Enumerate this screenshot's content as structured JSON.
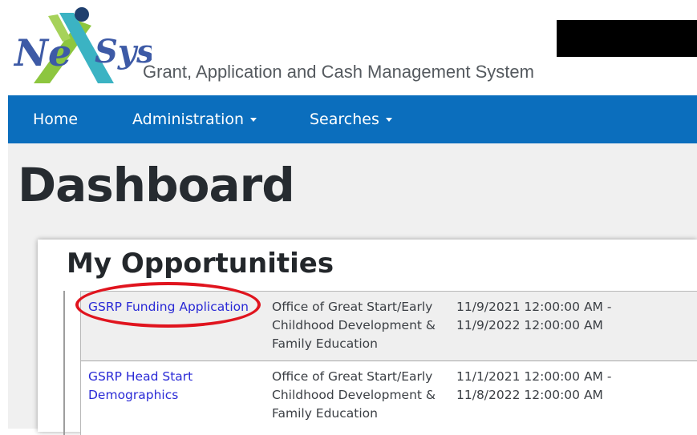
{
  "header": {
    "logo_text": "NeXSys",
    "tagline": "Grant, Application and Cash Management System",
    "colors": {
      "logo_blue": "#3d5aa6",
      "logo_green": "#8dc63f",
      "logo_teal": "#3bb3c3",
      "logo_navy": "#1f3f6e"
    }
  },
  "nav": {
    "items": [
      {
        "label": "Home",
        "has_dropdown": false
      },
      {
        "label": "Administration",
        "has_dropdown": true
      },
      {
        "label": "Searches",
        "has_dropdown": true
      }
    ],
    "color": "#0b6ebd"
  },
  "page": {
    "title": "Dashboard"
  },
  "opportunities": {
    "title": "My Opportunities",
    "rows": [
      {
        "name_lines": [
          "GSRP Funding Application"
        ],
        "office_lines": [
          "Office of Great Start/Early",
          "Childhood Development &",
          "Family Education"
        ],
        "date_lines": [
          "11/9/2021 12:00:00 AM -",
          "11/9/2022 12:00:00 AM"
        ]
      },
      {
        "name_lines": [
          "GSRP Head Start",
          "Demographics"
        ],
        "office_lines": [
          "Office of Great Start/Early",
          "Childhood Development &",
          "Family Education"
        ],
        "date_lines": [
          "11/1/2021 12:00:00 AM -",
          "11/8/2022 12:00:00 AM"
        ]
      }
    ]
  },
  "annotation": {
    "highlight_color": "#e0141e"
  }
}
